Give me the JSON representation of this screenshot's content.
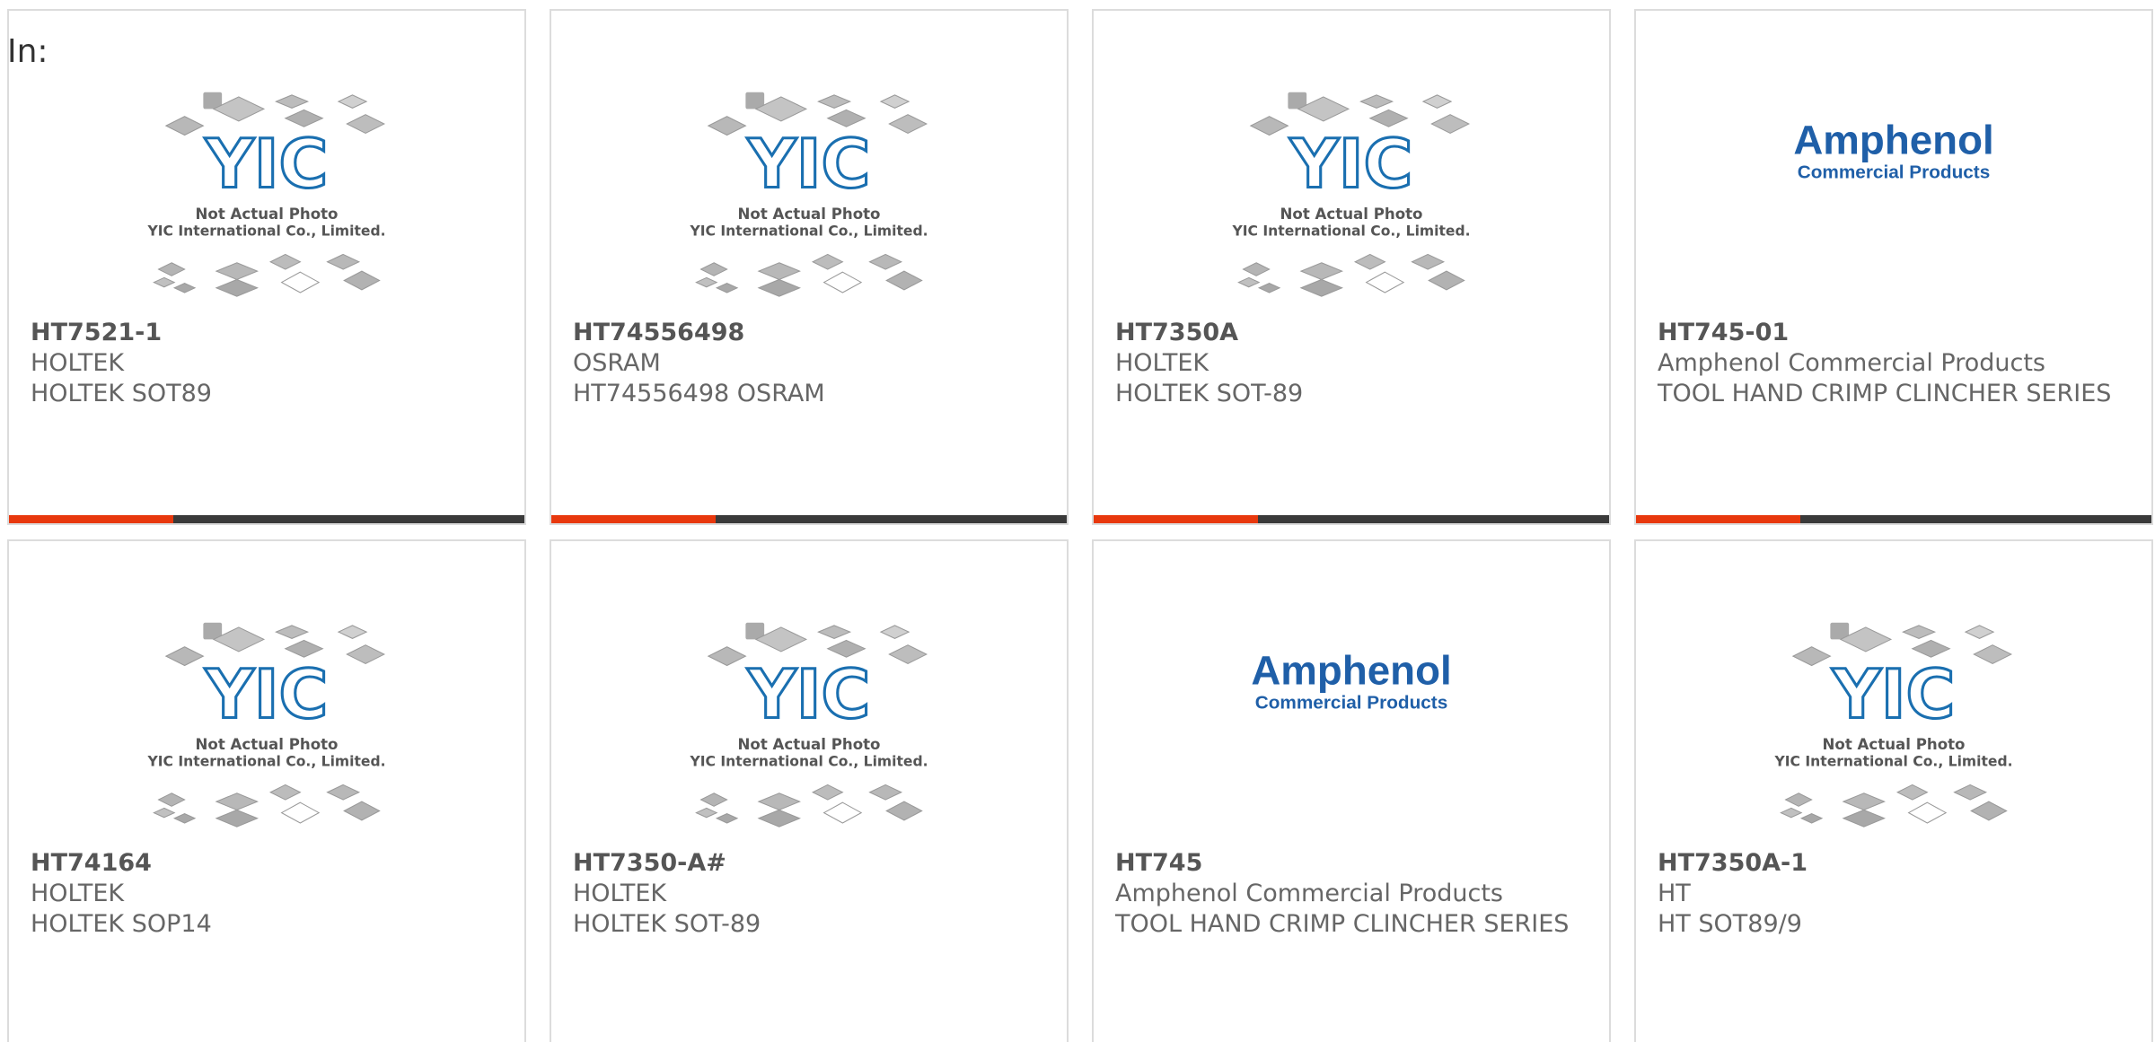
{
  "header": {
    "label": "In:"
  },
  "products": [
    {
      "part": "HT7521-1",
      "maker": "HOLTEK",
      "desc": "HOLTEK SOT89",
      "image": "yic"
    },
    {
      "part": "HT74556498",
      "maker": "OSRAM",
      "desc": "HT74556498 OSRAM",
      "image": "yic"
    },
    {
      "part": "HT7350A",
      "maker": "HOLTEK",
      "desc": "HOLTEK SOT-89",
      "image": "yic"
    },
    {
      "part": "HT745-01",
      "maker": "Amphenol Commercial Products",
      "desc": "TOOL HAND CRIMP CLINCHER SERIES",
      "image": "amphenol"
    },
    {
      "part": "HT74164",
      "maker": "HOLTEK",
      "desc": "HOLTEK SOP14",
      "image": "yic"
    },
    {
      "part": "HT7350-A#",
      "maker": "HOLTEK",
      "desc": "HOLTEK SOT-89",
      "image": "yic"
    },
    {
      "part": "HT745",
      "maker": "Amphenol Commercial Products",
      "desc": "TOOL HAND CRIMP CLINCHER SERIES",
      "image": "amphenol"
    },
    {
      "part": "HT7350A-1",
      "maker": "HT",
      "desc": "HT SOT89/9",
      "image": "yic"
    }
  ],
  "placeholder_image": {
    "logo_text": "YIC",
    "line1": "Not Actual Photo",
    "line2": "YIC International Co., Limited."
  },
  "amphenol_logo": {
    "line1": "Amphenol",
    "line2": "Commercial Products"
  },
  "colors": {
    "accent": "#e8380d",
    "bar": "#3a3a3a",
    "logo_blue": "#1a6fb0",
    "amphenol_blue": "#1f5fa8"
  }
}
